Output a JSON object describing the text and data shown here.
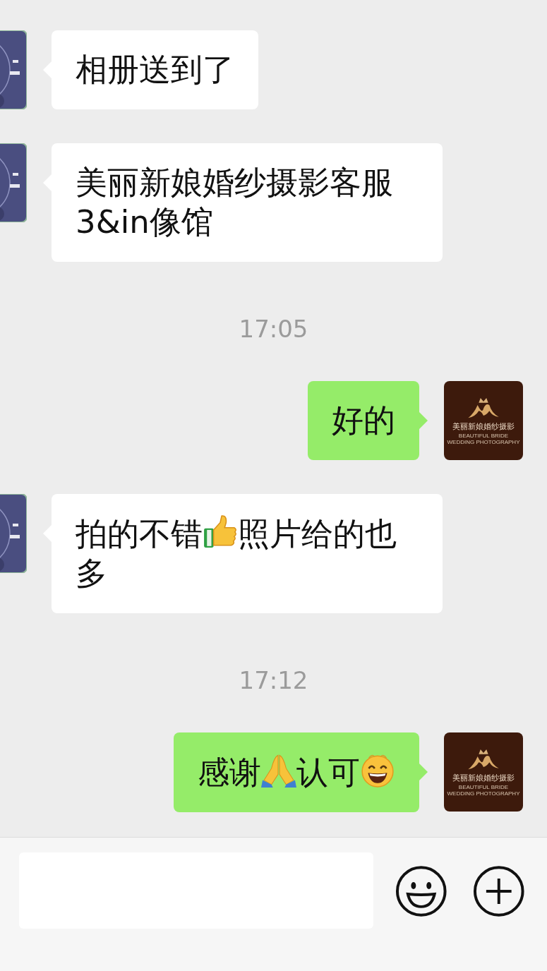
{
  "messages": [
    {
      "kind": "message",
      "from_me": false,
      "parts": [
        {
          "kind": "text",
          "text": "相册送到了"
        }
      ]
    },
    {
      "kind": "message",
      "from_me": false,
      "parts": [
        {
          "kind": "text",
          "text": "美丽新娘婚纱摄影客服3&in像馆"
        }
      ]
    },
    {
      "kind": "time",
      "text": "17:05"
    },
    {
      "kind": "message",
      "from_me": true,
      "avatar": {
        "title": "美丽新娘婚纱摄影",
        "subtitle": "BEAUTIFUL BRIDE WEDDING PHOTOGRAPHY"
      },
      "parts": [
        {
          "kind": "text",
          "text": "好的"
        }
      ]
    },
    {
      "kind": "message",
      "from_me": false,
      "parts": [
        {
          "kind": "text",
          "text": "拍的不错"
        },
        {
          "kind": "thumbsup"
        },
        {
          "kind": "text",
          "text": "照片给的也"
        },
        {
          "kind": "text",
          "text": "多"
        }
      ]
    },
    {
      "kind": "time",
      "text": "17:12"
    },
    {
      "kind": "message",
      "from_me": true,
      "avatar": {
        "title": "美丽新娘婚纱摄影",
        "subtitle": "BEAUTIFUL BRIDE WEDDING PHOTOGRAPHY"
      },
      "parts": [
        {
          "kind": "text",
          "text": "感谢"
        },
        {
          "kind": "pray"
        },
        {
          "kind": "text",
          "text": "认可"
        },
        {
          "kind": "grin"
        }
      ]
    }
  ]
}
